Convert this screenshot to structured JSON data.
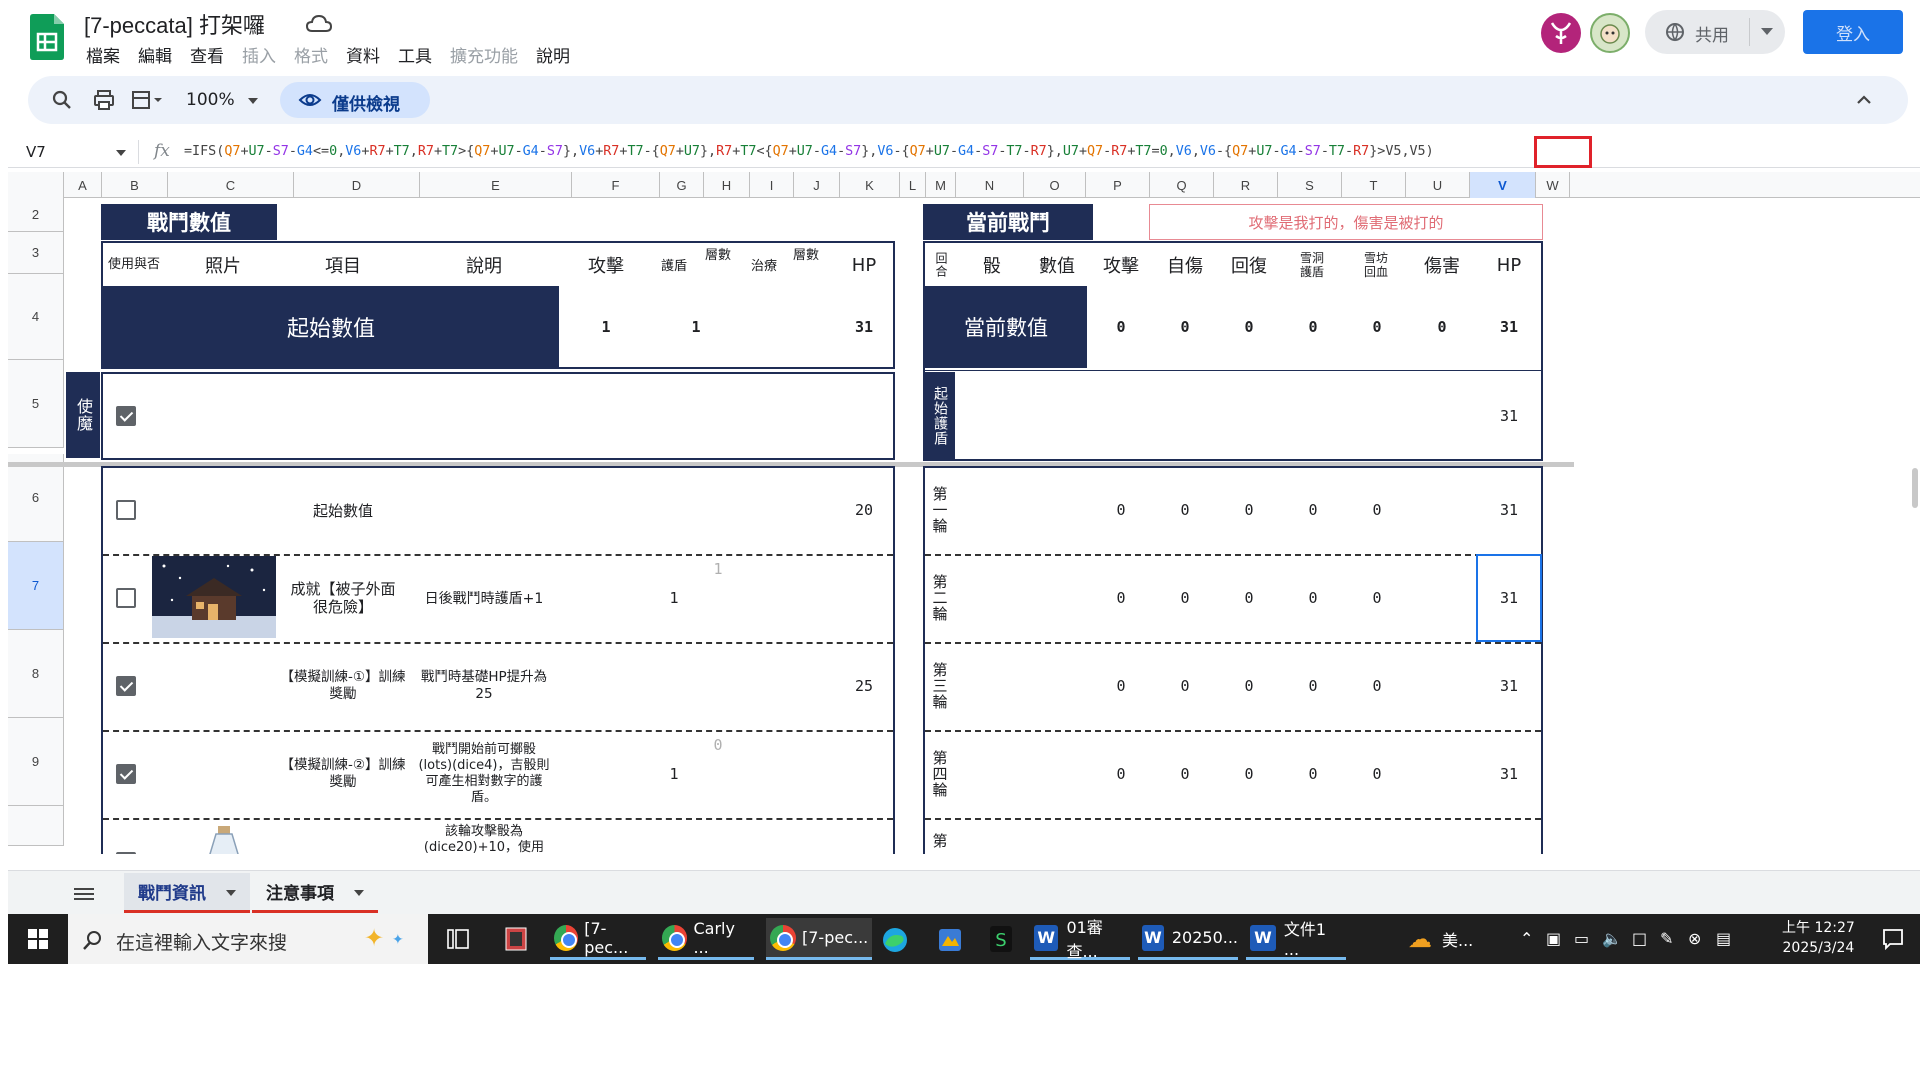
{
  "doc": {
    "title": "[7-peccata] 打架囉"
  },
  "menu": [
    "檔案",
    "編輯",
    "查看",
    "插入",
    "格式",
    "資料",
    "工具",
    "擴充功能",
    "說明"
  ],
  "menu_disabled": [
    false,
    false,
    false,
    true,
    true,
    false,
    false,
    true,
    false
  ],
  "header": {
    "share_label": "共用",
    "login_label": "登入"
  },
  "toolbar": {
    "zoom": "100%",
    "view_only": "僅供檢視"
  },
  "formula": {
    "cell_ref": "V7",
    "parts": [
      {
        "t": "=IFS(",
        "c": "#444444"
      },
      {
        "t": "Q7",
        "c": "#e37400"
      },
      {
        "t": "+",
        "c": "#444444"
      },
      {
        "t": "U7",
        "c": "#188038"
      },
      {
        "t": "-",
        "c": "#444444"
      },
      {
        "t": "S7",
        "c": "#9334e6"
      },
      {
        "t": "-",
        "c": "#444444"
      },
      {
        "t": "G4",
        "c": "#1a73e8"
      },
      {
        "t": "<=",
        "c": "#444444"
      },
      {
        "t": "0",
        "c": "#188038"
      },
      {
        "t": ",",
        "c": "#444444"
      },
      {
        "t": "V6",
        "c": "#1a73e8"
      },
      {
        "t": "+",
        "c": "#444444"
      },
      {
        "t": "R7",
        "c": "#d93025"
      },
      {
        "t": "+",
        "c": "#444444"
      },
      {
        "t": "T7",
        "c": "#188038"
      },
      {
        "t": ",",
        "c": "#444444"
      },
      {
        "t": "R7",
        "c": "#d93025"
      },
      {
        "t": "+",
        "c": "#444444"
      },
      {
        "t": "T7",
        "c": "#188038"
      },
      {
        "t": ">{",
        "c": "#444444"
      },
      {
        "t": "Q7",
        "c": "#e37400"
      },
      {
        "t": "+",
        "c": "#444444"
      },
      {
        "t": "U7",
        "c": "#188038"
      },
      {
        "t": "-",
        "c": "#444444"
      },
      {
        "t": "G4",
        "c": "#1a73e8"
      },
      {
        "t": "-",
        "c": "#444444"
      },
      {
        "t": "S7",
        "c": "#9334e6"
      },
      {
        "t": "},",
        "c": "#444444"
      },
      {
        "t": "V6",
        "c": "#1a73e8"
      },
      {
        "t": "+",
        "c": "#444444"
      },
      {
        "t": "R7",
        "c": "#d93025"
      },
      {
        "t": "+",
        "c": "#444444"
      },
      {
        "t": "T7",
        "c": "#188038"
      },
      {
        "t": "-{",
        "c": "#444444"
      },
      {
        "t": "Q7",
        "c": "#e37400"
      },
      {
        "t": "+",
        "c": "#444444"
      },
      {
        "t": "U7",
        "c": "#188038"
      },
      {
        "t": "},",
        "c": "#444444"
      },
      {
        "t": "R7",
        "c": "#d93025"
      },
      {
        "t": "+",
        "c": "#444444"
      },
      {
        "t": "T7",
        "c": "#188038"
      },
      {
        "t": "<{",
        "c": "#444444"
      },
      {
        "t": "Q7",
        "c": "#e37400"
      },
      {
        "t": "+",
        "c": "#444444"
      },
      {
        "t": "U7",
        "c": "#188038"
      },
      {
        "t": "-",
        "c": "#444444"
      },
      {
        "t": "G4",
        "c": "#1a73e8"
      },
      {
        "t": "-",
        "c": "#444444"
      },
      {
        "t": "S7",
        "c": "#9334e6"
      },
      {
        "t": "},",
        "c": "#444444"
      },
      {
        "t": "V6",
        "c": "#1a73e8"
      },
      {
        "t": "-{",
        "c": "#444444"
      },
      {
        "t": "Q7",
        "c": "#e37400"
      },
      {
        "t": "+",
        "c": "#444444"
      },
      {
        "t": "U7",
        "c": "#188038"
      },
      {
        "t": "-",
        "c": "#444444"
      },
      {
        "t": "G4",
        "c": "#1a73e8"
      },
      {
        "t": "-",
        "c": "#444444"
      },
      {
        "t": "S7",
        "c": "#9334e6"
      },
      {
        "t": "-",
        "c": "#444444"
      },
      {
        "t": "T7",
        "c": "#188038"
      },
      {
        "t": "-",
        "c": "#444444"
      },
      {
        "t": "R7",
        "c": "#d93025"
      },
      {
        "t": "},",
        "c": "#444444"
      },
      {
        "t": "U7",
        "c": "#188038"
      },
      {
        "t": "+",
        "c": "#444444"
      },
      {
        "t": "Q7",
        "c": "#e37400"
      },
      {
        "t": "-",
        "c": "#444444"
      },
      {
        "t": "R7",
        "c": "#d93025"
      },
      {
        "t": "+",
        "c": "#444444"
      },
      {
        "t": "T7",
        "c": "#188038"
      },
      {
        "t": "=",
        "c": "#444444"
      },
      {
        "t": "0",
        "c": "#188038"
      },
      {
        "t": ",",
        "c": "#444444"
      },
      {
        "t": "V6",
        "c": "#1a73e8"
      },
      {
        "t": ",",
        "c": "#444444"
      },
      {
        "t": "V6",
        "c": "#1a73e8"
      },
      {
        "t": "-{",
        "c": "#444444"
      },
      {
        "t": "Q7",
        "c": "#e37400"
      },
      {
        "t": "+",
        "c": "#444444"
      },
      {
        "t": "U7",
        "c": "#188038"
      },
      {
        "t": "-",
        "c": "#444444"
      },
      {
        "t": "G4",
        "c": "#1a73e8"
      },
      {
        "t": "-",
        "c": "#444444"
      },
      {
        "t": "S7",
        "c": "#9334e6"
      },
      {
        "t": "-",
        "c": "#444444"
      },
      {
        "t": "T7",
        "c": "#188038"
      },
      {
        "t": "-",
        "c": "#444444"
      },
      {
        "t": "R7",
        "c": "#d93025"
      },
      {
        "t": "}>",
        "c": "#444444"
      },
      {
        "t": "V5",
        "c": "#444444"
      },
      {
        "t": ",",
        "c": "#444444"
      },
      {
        "t": "V5",
        "c": "#444444"
      },
      {
        "t": ")",
        "c": "#444444"
      }
    ]
  },
  "columns": [
    "A",
    "B",
    "C",
    "D",
    "E",
    "F",
    "G",
    "H",
    "I",
    "J",
    "K",
    "L",
    "M",
    "N",
    "O",
    "P",
    "Q",
    "R",
    "S",
    "T",
    "U",
    "V",
    "W"
  ],
  "selected_column": "V",
  "rows": [
    "2",
    "3",
    "4",
    "5",
    "6",
    "7",
    "8",
    "9",
    ""
  ],
  "selected_row": "7",
  "left_table": {
    "tab": "戰鬥數值",
    "headers": {
      "use": "使用與否",
      "photo": "照片",
      "item": "項目",
      "desc": "說明",
      "atk": "攻擊",
      "shield": "護盾",
      "layers1": "層數",
      "heal": "治療",
      "layers2": "層數",
      "hp": "HP"
    },
    "start_label": "起始數值",
    "start_atk": "1",
    "start_shield": "1",
    "start_hp": "31",
    "familiar_label": "使魔",
    "row6": {
      "item": "起始數值",
      "hp": "20"
    },
    "row7": {
      "item": "成就【被子外面很危險】",
      "desc": "日後戰鬥時護盾+1",
      "shield": "1",
      "layer": "1"
    },
    "row8": {
      "item": "【模擬訓練-①】訓練獎勵",
      "desc": "戰鬥時基礎HP提升為25",
      "hp": "25"
    },
    "row9": {
      "item": "【模擬訓練-②】訓練獎勵",
      "desc": "戰鬥開始前可擲骰(lots)(dice4)，吉骰則可產生相對數字的護盾。",
      "shield": "1",
      "layer": "0"
    },
    "row10": {
      "desc": "該輪攻擊骰為(dice20)+10，使用"
    }
  },
  "right_table": {
    "tab": "當前戰鬥",
    "note": "攻擊是我打的，傷害是被打的",
    "headers": {
      "round": "回合",
      "dice": "骰",
      "value": "數值",
      "atk": "攻擊",
      "self_dmg": "自傷",
      "recover": "回復",
      "shield_gain": "雪洞護盾",
      "hp_gain": "雪坊回血",
      "damage": "傷害",
      "hp": "HP"
    },
    "current_label": "當前數值",
    "current": [
      "0",
      "0",
      "0",
      "0",
      "0",
      "0",
      "31"
    ],
    "row5": {
      "label": "起始護盾",
      "hp": "31"
    },
    "rounds": [
      {
        "label": "第一輪",
        "vals": [
          "0",
          "0",
          "0",
          "0",
          "0"
        ],
        "hp": "31"
      },
      {
        "label": "第二輪",
        "vals": [
          "0",
          "0",
          "0",
          "0",
          "0"
        ],
        "hp": "31"
      },
      {
        "label": "第三輪",
        "vals": [
          "0",
          "0",
          "0",
          "0",
          "0"
        ],
        "hp": "31"
      },
      {
        "label": "第四輪",
        "vals": [
          "0",
          "0",
          "0",
          "0",
          "0"
        ],
        "hp": "31"
      }
    ],
    "row10_label": "第"
  },
  "sheet_tabs": [
    "戰鬥資訊",
    "注意事項"
  ],
  "taskbar": {
    "search_placeholder": "在這裡輸入文字來搜",
    "apps": [
      "[7-pec...",
      "Carly ...",
      "[7-pec...",
      "01審查...",
      "20250...",
      "文件1 ...",
      "美..."
    ],
    "time": "上午 12:27",
    "date": "2025/3/24"
  },
  "colors": {
    "navy": "#1f2d55",
    "accent": "#1a73e8",
    "highlight": "#e0222a",
    "note_text": "#e06c75"
  }
}
